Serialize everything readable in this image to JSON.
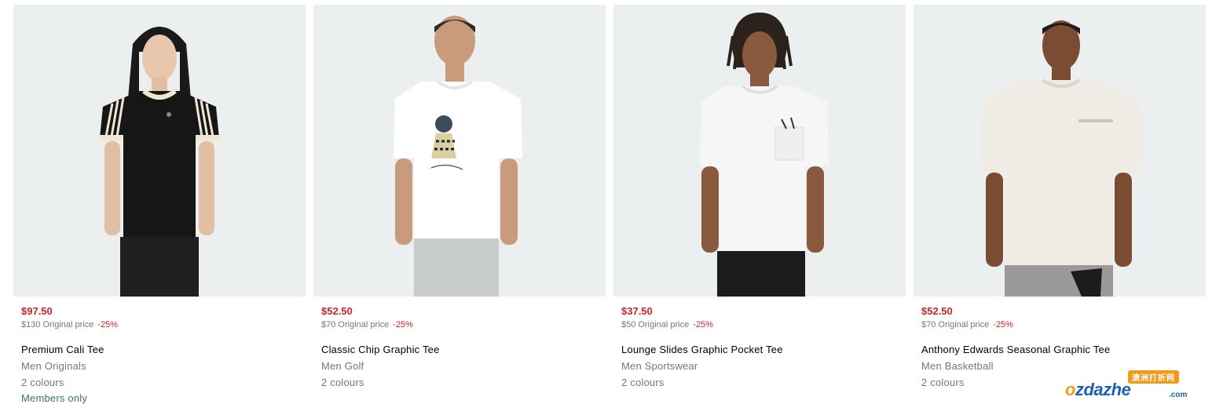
{
  "products": [
    {
      "price": "$97.50",
      "original_price": "$130 Original price",
      "discount": "-25%",
      "title": "Premium Cali Tee",
      "subtitle": "Men Originals",
      "colours": "2 colours",
      "members": "Members only"
    },
    {
      "price": "$52.50",
      "original_price": "$70 Original price",
      "discount": "-25%",
      "title": "Classic Chip Graphic Tee",
      "subtitle": "Men Golf",
      "colours": "2 colours"
    },
    {
      "price": "$37.50",
      "original_price": "$50 Original price",
      "discount": "-25%",
      "title": "Lounge Slides Graphic Pocket Tee",
      "subtitle": "Men Sportswear",
      "colours": "2 colours"
    },
    {
      "price": "$52.50",
      "original_price": "$70 Original price",
      "discount": "-25%",
      "title": "Anthony Edwards Seasonal Graphic Tee",
      "subtitle": "Men Basketball",
      "colours": "2 colours"
    }
  ],
  "watermark": {
    "badge": "澳洲打折网",
    "logo_o": "o",
    "logo_rest": "zdazhe",
    "domain": ".com"
  },
  "colors": {
    "sale_price": "#c8252b",
    "muted_text": "#767677",
    "members_text": "#3a7a55",
    "image_bg": "#eceff0"
  }
}
